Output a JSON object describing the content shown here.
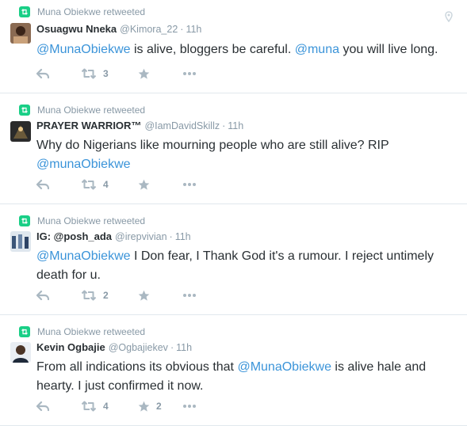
{
  "colors": {
    "retweet_green": "#19cf86",
    "mention_blue": "#3b94d9",
    "meta_gray": "#8899a6",
    "action_gray": "#aab8c2"
  },
  "tweets": [
    {
      "retweeted_by": "Muna Obiekwe retweeted",
      "fullname": "Osuagwu Nneka",
      "username": "@Kimora_22",
      "dot": "·",
      "time": "11h",
      "text": [
        {
          "type": "mention",
          "text": "@MunaObiekwe"
        },
        {
          "type": "plain",
          "text": " is alive, bloggers be careful. "
        },
        {
          "type": "mention",
          "text": "@muna"
        },
        {
          "type": "plain",
          "text": " you will live long."
        }
      ],
      "retweet_count": "3",
      "favorite_count": "",
      "avatar_icon": "avatar-photo"
    },
    {
      "retweeted_by": "Muna Obiekwe retweeted",
      "fullname": "PRAYER WARRIOR™",
      "username": "@IamDavidSkillz",
      "dot": "·",
      "time": "11h",
      "text": [
        {
          "type": "plain",
          "text": "Why do Nigerians like mourning people who are still alive? RIP "
        },
        {
          "type": "mention",
          "text": "@munaObiekwe"
        }
      ],
      "retweet_count": "4",
      "favorite_count": "",
      "avatar_icon": "avatar-photo"
    },
    {
      "retweeted_by": "Muna Obiekwe retweeted",
      "fullname": "IG: @posh_ada",
      "username": "@irepvivian",
      "dot": "·",
      "time": "11h",
      "text": [
        {
          "type": "mention",
          "text": "@MunaObiekwe"
        },
        {
          "type": "plain",
          "text": " I Don fear, I Thank God it's a rumour. I reject untimely death for u."
        }
      ],
      "retweet_count": "2",
      "favorite_count": "",
      "avatar_icon": "avatar-photo"
    },
    {
      "retweeted_by": "Muna Obiekwe retweeted",
      "fullname": "Kevin Ogbajie",
      "username": "@Ogbajiekev",
      "dot": "·",
      "time": "11h",
      "text": [
        {
          "type": "plain",
          "text": "From all indications its obvious that "
        },
        {
          "type": "mention",
          "text": "@MunaObiekwe"
        },
        {
          "type": "plain",
          "text": "  is alive hale and hearty. I just confirmed it now."
        }
      ],
      "retweet_count": "4",
      "favorite_count": "2",
      "avatar_icon": "avatar-photo"
    }
  ]
}
